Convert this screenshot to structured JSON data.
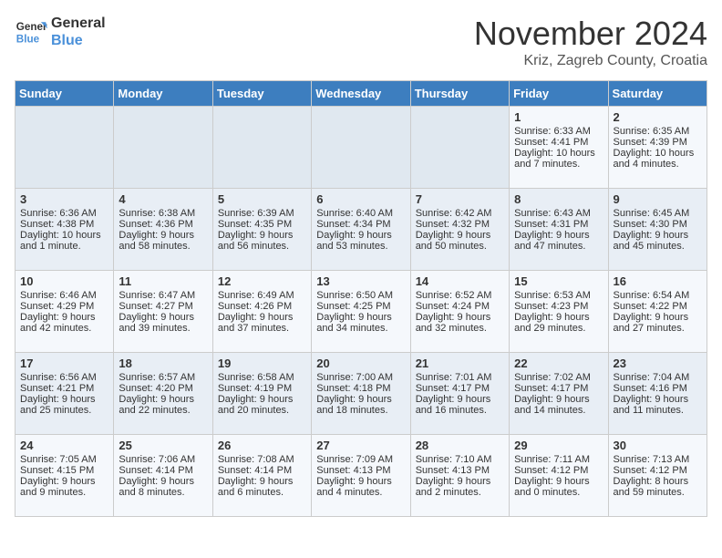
{
  "logo": {
    "line1": "General",
    "line2": "Blue"
  },
  "title": "November 2024",
  "location": "Kriz, Zagreb County, Croatia",
  "days_of_week": [
    "Sunday",
    "Monday",
    "Tuesday",
    "Wednesday",
    "Thursday",
    "Friday",
    "Saturday"
  ],
  "weeks": [
    [
      {
        "day": "",
        "info": ""
      },
      {
        "day": "",
        "info": ""
      },
      {
        "day": "",
        "info": ""
      },
      {
        "day": "",
        "info": ""
      },
      {
        "day": "",
        "info": ""
      },
      {
        "day": "1",
        "info": "Sunrise: 6:33 AM\nSunset: 4:41 PM\nDaylight: 10 hours and 7 minutes."
      },
      {
        "day": "2",
        "info": "Sunrise: 6:35 AM\nSunset: 4:39 PM\nDaylight: 10 hours and 4 minutes."
      }
    ],
    [
      {
        "day": "3",
        "info": "Sunrise: 6:36 AM\nSunset: 4:38 PM\nDaylight: 10 hours and 1 minute."
      },
      {
        "day": "4",
        "info": "Sunrise: 6:38 AM\nSunset: 4:36 PM\nDaylight: 9 hours and 58 minutes."
      },
      {
        "day": "5",
        "info": "Sunrise: 6:39 AM\nSunset: 4:35 PM\nDaylight: 9 hours and 56 minutes."
      },
      {
        "day": "6",
        "info": "Sunrise: 6:40 AM\nSunset: 4:34 PM\nDaylight: 9 hours and 53 minutes."
      },
      {
        "day": "7",
        "info": "Sunrise: 6:42 AM\nSunset: 4:32 PM\nDaylight: 9 hours and 50 minutes."
      },
      {
        "day": "8",
        "info": "Sunrise: 6:43 AM\nSunset: 4:31 PM\nDaylight: 9 hours and 47 minutes."
      },
      {
        "day": "9",
        "info": "Sunrise: 6:45 AM\nSunset: 4:30 PM\nDaylight: 9 hours and 45 minutes."
      }
    ],
    [
      {
        "day": "10",
        "info": "Sunrise: 6:46 AM\nSunset: 4:29 PM\nDaylight: 9 hours and 42 minutes."
      },
      {
        "day": "11",
        "info": "Sunrise: 6:47 AM\nSunset: 4:27 PM\nDaylight: 9 hours and 39 minutes."
      },
      {
        "day": "12",
        "info": "Sunrise: 6:49 AM\nSunset: 4:26 PM\nDaylight: 9 hours and 37 minutes."
      },
      {
        "day": "13",
        "info": "Sunrise: 6:50 AM\nSunset: 4:25 PM\nDaylight: 9 hours and 34 minutes."
      },
      {
        "day": "14",
        "info": "Sunrise: 6:52 AM\nSunset: 4:24 PM\nDaylight: 9 hours and 32 minutes."
      },
      {
        "day": "15",
        "info": "Sunrise: 6:53 AM\nSunset: 4:23 PM\nDaylight: 9 hours and 29 minutes."
      },
      {
        "day": "16",
        "info": "Sunrise: 6:54 AM\nSunset: 4:22 PM\nDaylight: 9 hours and 27 minutes."
      }
    ],
    [
      {
        "day": "17",
        "info": "Sunrise: 6:56 AM\nSunset: 4:21 PM\nDaylight: 9 hours and 25 minutes."
      },
      {
        "day": "18",
        "info": "Sunrise: 6:57 AM\nSunset: 4:20 PM\nDaylight: 9 hours and 22 minutes."
      },
      {
        "day": "19",
        "info": "Sunrise: 6:58 AM\nSunset: 4:19 PM\nDaylight: 9 hours and 20 minutes."
      },
      {
        "day": "20",
        "info": "Sunrise: 7:00 AM\nSunset: 4:18 PM\nDaylight: 9 hours and 18 minutes."
      },
      {
        "day": "21",
        "info": "Sunrise: 7:01 AM\nSunset: 4:17 PM\nDaylight: 9 hours and 16 minutes."
      },
      {
        "day": "22",
        "info": "Sunrise: 7:02 AM\nSunset: 4:17 PM\nDaylight: 9 hours and 14 minutes."
      },
      {
        "day": "23",
        "info": "Sunrise: 7:04 AM\nSunset: 4:16 PM\nDaylight: 9 hours and 11 minutes."
      }
    ],
    [
      {
        "day": "24",
        "info": "Sunrise: 7:05 AM\nSunset: 4:15 PM\nDaylight: 9 hours and 9 minutes."
      },
      {
        "day": "25",
        "info": "Sunrise: 7:06 AM\nSunset: 4:14 PM\nDaylight: 9 hours and 8 minutes."
      },
      {
        "day": "26",
        "info": "Sunrise: 7:08 AM\nSunset: 4:14 PM\nDaylight: 9 hours and 6 minutes."
      },
      {
        "day": "27",
        "info": "Sunrise: 7:09 AM\nSunset: 4:13 PM\nDaylight: 9 hours and 4 minutes."
      },
      {
        "day": "28",
        "info": "Sunrise: 7:10 AM\nSunset: 4:13 PM\nDaylight: 9 hours and 2 minutes."
      },
      {
        "day": "29",
        "info": "Sunrise: 7:11 AM\nSunset: 4:12 PM\nDaylight: 9 hours and 0 minutes."
      },
      {
        "day": "30",
        "info": "Sunrise: 7:13 AM\nSunset: 4:12 PM\nDaylight: 8 hours and 59 minutes."
      }
    ]
  ]
}
